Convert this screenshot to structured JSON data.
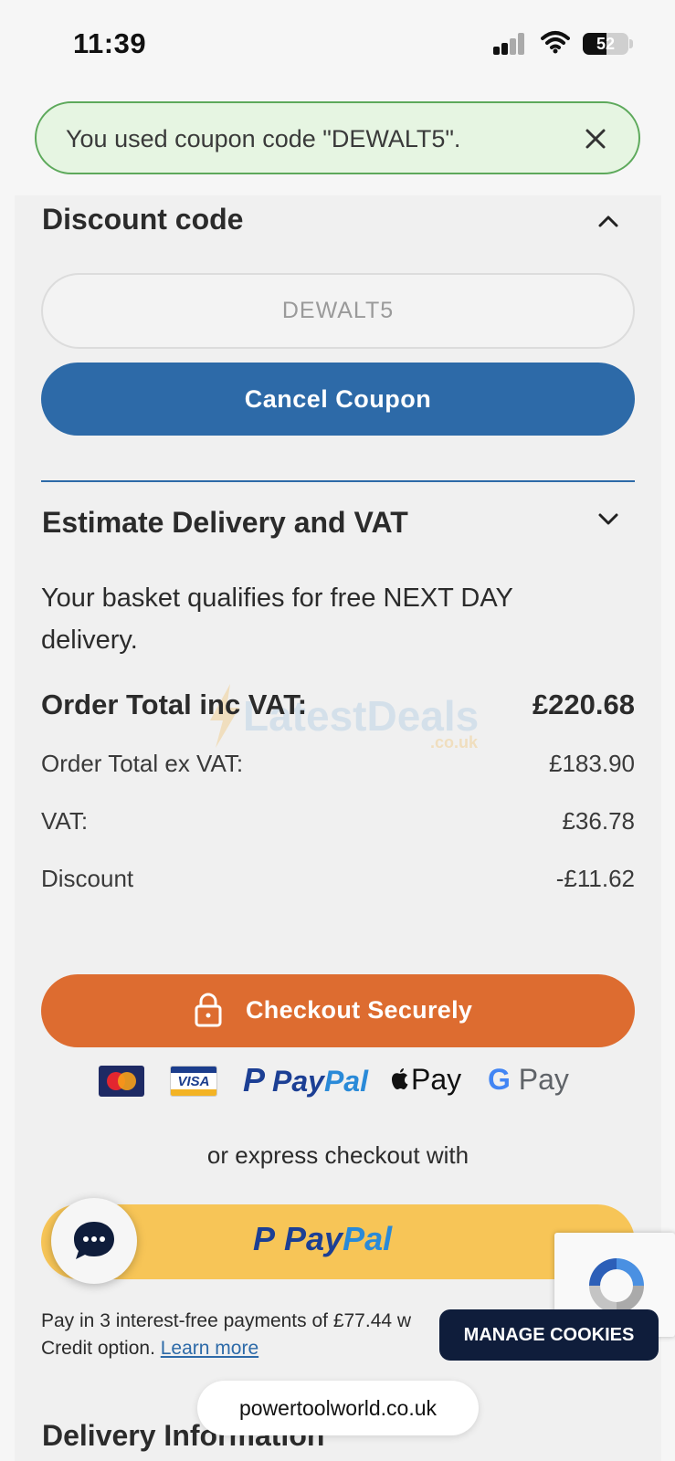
{
  "status_bar": {
    "time": "11:39",
    "battery": "52"
  },
  "banner": {
    "message": "You used coupon code \"DEWALT5\"."
  },
  "discount": {
    "title": "Discount code",
    "code_value": "DEWALT5",
    "cancel_label": "Cancel Coupon"
  },
  "delivery": {
    "title": "Estimate Delivery and VAT",
    "note": "Your basket qualifies for free NEXT DAY delivery."
  },
  "totals": {
    "inc_vat_label": "Order Total inc VAT:",
    "inc_vat_value": "£220.68",
    "ex_vat_label": "Order Total ex VAT:",
    "ex_vat_value": "£183.90",
    "vat_label": "VAT:",
    "vat_value": "£36.78",
    "discount_label": "Discount",
    "discount_value": "-£11.62"
  },
  "watermark": {
    "main": "LatestDeals",
    "sub": ".co.uk"
  },
  "checkout": {
    "label": "Checkout Securely",
    "payment_methods": {
      "visa": "VISA",
      "paypal_pay": "Pay",
      "paypal_pal": "Pal",
      "apple_pay": "Pay",
      "google_g": "G",
      "google_pay": "Pay"
    }
  },
  "express": {
    "label": "or express checkout with",
    "paypal_pay": "Pay",
    "paypal_pal": "Pal"
  },
  "credit": {
    "text": "Pay in 3 interest-free payments of £77.44 w",
    "text2": "Credit option.",
    "link": "Learn more"
  },
  "next_section": {
    "title": "Delivery Information"
  },
  "overlays": {
    "cookies_label": "MANAGE COOKIES",
    "url": "powertoolworld.co.uk"
  },
  "colors": {
    "primary_blue": "#2d6aa8",
    "checkout_orange": "#dd6c30",
    "paypal_yellow": "#f7c557",
    "success_green": "#5da95b"
  }
}
